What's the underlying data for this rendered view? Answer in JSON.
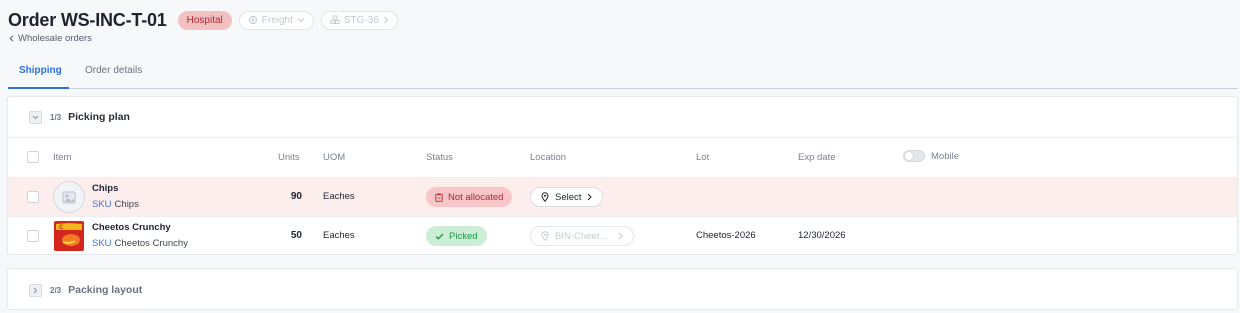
{
  "order": {
    "title": "Order WS-INC-T-01",
    "tag": "Hospital",
    "carrier": "Freight",
    "stage": "STG-36",
    "back_label": "Wholesale orders"
  },
  "tabs": [
    {
      "label": "Shipping",
      "active": true
    },
    {
      "label": "Order details",
      "active": false
    }
  ],
  "picking": {
    "step": "1/3",
    "title": "Picking plan",
    "columns": {
      "item": "Item",
      "units": "Units",
      "uom": "UOM",
      "status": "Status",
      "location": "Location",
      "lot": "Lot",
      "exp": "Exp date",
      "mobile": "Mobile"
    },
    "rows": [
      {
        "name": "Chips",
        "sku_label": "SKU",
        "sku": "Chips",
        "units": "90",
        "uom": "Eaches",
        "status": "Not allocated",
        "location": "Select",
        "lot": "",
        "exp": ""
      },
      {
        "name": "Cheetos Crunchy",
        "sku_label": "SKU",
        "sku": "Cheetos Crunchy",
        "units": "50",
        "uom": "Eaches",
        "status": "Picked",
        "location": "BIN-Cheet...",
        "lot": "Cheetos-2026",
        "exp": "12/30/2026"
      }
    ]
  },
  "packing": {
    "step": "2/3",
    "title": "Packing layout"
  },
  "colors": {
    "accent": "#2f6fd6",
    "danger_bg": "#fdeeee",
    "danger": "#b3262e",
    "success": "#23944a"
  }
}
